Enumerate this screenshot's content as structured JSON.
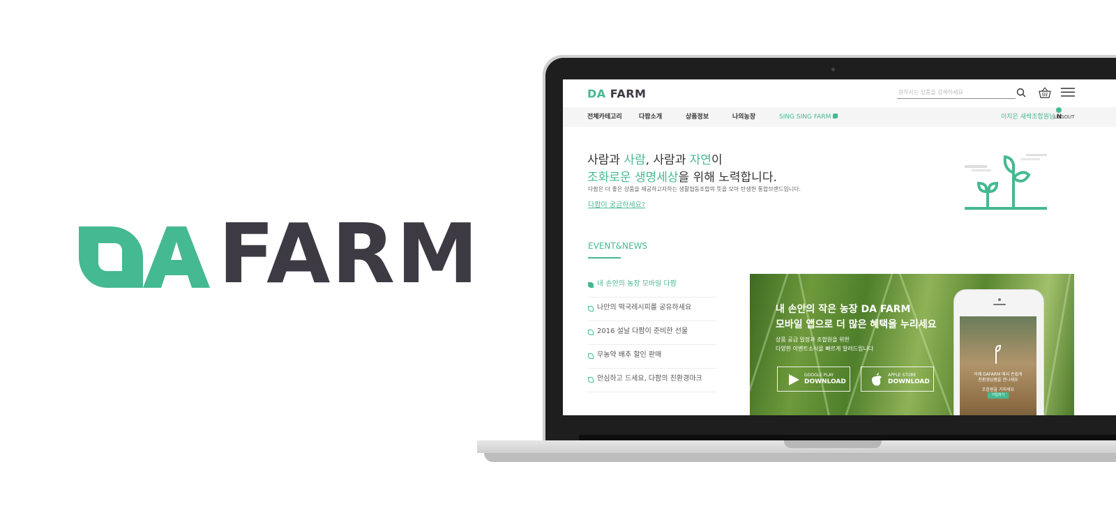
{
  "brand": {
    "logo_prefix": "DA",
    "logo_word": "FARM",
    "green": "#45b991",
    "dark": "#3d3a43"
  },
  "header": {
    "logo_prefix": "DA",
    "logo_word": "FARM",
    "search_placeholder": "원하시는 상품을 검색하세요",
    "icons": [
      "search-icon",
      "basket-icon",
      "menu-icon"
    ]
  },
  "nav": {
    "items": [
      "전체카테고리",
      "다팜소개",
      "상품정보",
      "나의농장",
      "SING SING FARM"
    ],
    "user": "이지은 새싹조합원님",
    "user_badge": "N",
    "logout": "LOGOUT"
  },
  "hero": {
    "l1_a": "사람과 ",
    "l1_b": "사람",
    "l1_c": ", 사람과 ",
    "l1_d": "자연",
    "l1_e": "이",
    "l2_a": "조화로운 생명세상",
    "l2_b": "을 위해 노력합니다.",
    "sub": "다팜은 더 좋은 상품을 제공하고자하는 생활협동조합의 뜻을 모아 탄생한 통합브랜드입니다.",
    "link": "다팜이 궁금하세요?"
  },
  "events": {
    "title": "EVENT&NEWS",
    "items": [
      "내 손안의 농장 모바일 다팜",
      "나만의 떡국레시피를 공유하세요",
      "2016 설날 다팜이 준비한 선물",
      "무농약 배추 할인 판매",
      "안심하고 드세요, 다팜의 친환경마크"
    ]
  },
  "banner": {
    "line1_a": "내 손안의 작은 농장 ",
    "line1_b": "DA FARM",
    "line2": "모바일 앱으로 더 많은 혜택을 누리세요",
    "line3": "상품 공급 일정과 조합원을 위한",
    "line4": "다양한 이벤트소식을 빠르게 알려드립니다",
    "google_small": "GOOGLE PLAY",
    "google_big": "DOWNLOAD",
    "apple_small": "APPLE STORE",
    "apple_big": "DOWNLOAD",
    "phone_l1": "이제 DAFARM 에서 손쉽게",
    "phone_l2": "친환경상품을 만나세요",
    "phone_l3": "조합원을 가지세요",
    "phone_btn": "가입하기"
  }
}
